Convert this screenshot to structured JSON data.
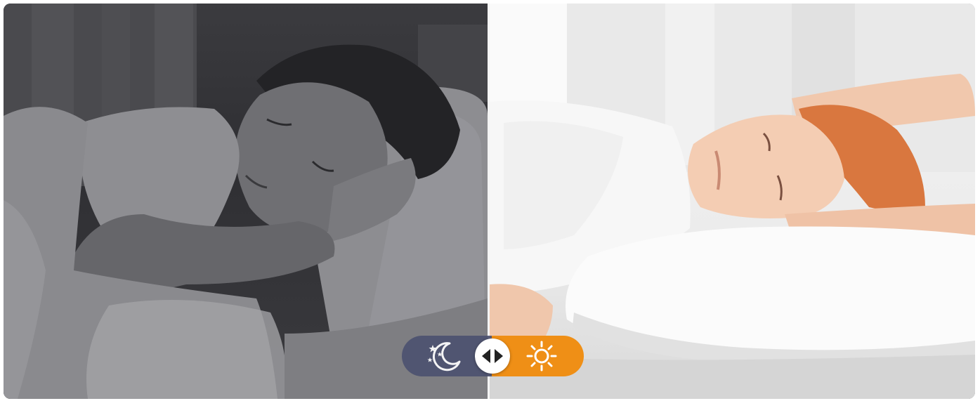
{
  "scene": {
    "night_mode": "night",
    "day_mode": "day"
  },
  "toggle": {
    "night_icon": "moon-stars-icon",
    "day_icon": "sun-icon",
    "handle_icon": "left-right-arrows-icon",
    "active": "split",
    "colors": {
      "night_bg": "#4d5270",
      "day_bg": "#ef8f16",
      "handle_bg": "#ffffff"
    }
  },
  "illustrations": {
    "night": "sleeping-girl-image",
    "day": "waking-child-image"
  }
}
